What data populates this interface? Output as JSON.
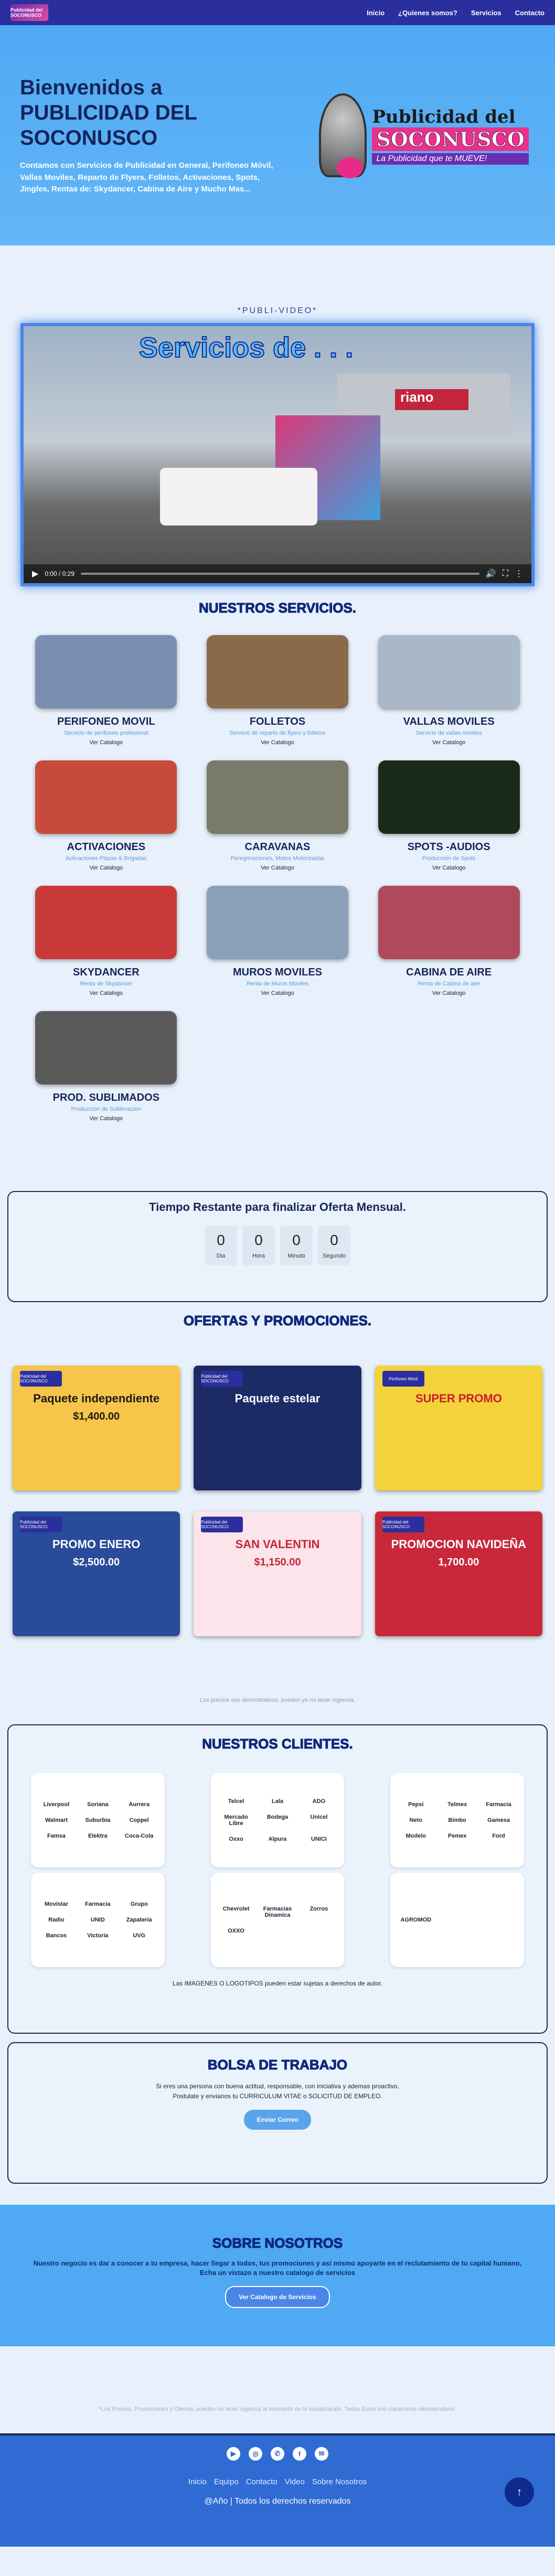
{
  "nav": {
    "logo_text": "Publicidad del SOCONUSCO",
    "links": [
      "Inicio",
      "¿Quienes somos?",
      "Servicios",
      "Contacto"
    ]
  },
  "hero": {
    "title": "Bienvenidos a PUBLICIDAD DEL SOCONUSCO",
    "subtitle": "Contamos con Servicios de Publicidad en General, Perifoneo Móvil, Vallas Moviles, Reparto de Flyers, Folletos, Activaciones, Spots, Jingles, Rentas de: Skydancer, Cabina de Aire y Mucho Mas...",
    "brand_line1": "Publicidad del",
    "brand_line2": "SOCONUSCO",
    "brand_line3": "La Publicidad que te MUEVE!"
  },
  "video": {
    "label": "*PUBLI-VIDEO*",
    "caption": "Servicios de . . .",
    "sign_text": "riano",
    "time": "0:00 / 0:29"
  },
  "services": {
    "title": "NUESTROS SERVICIOS.",
    "items": [
      {
        "title": "PERIFONEO MOVIL",
        "desc": "Servicio de perifoneo profesional",
        "link": "Ver Catalogo",
        "color": "#7a8fb0"
      },
      {
        "title": "FOLLETOS",
        "desc": "Servicio de reparto de flyers y folletos",
        "link": "Ver Catalogo",
        "color": "#8a6a4a"
      },
      {
        "title": "VALLAS MOVILES",
        "desc": "Servicio de vallas moviles",
        "link": "Ver Catalogo",
        "color": "#a8b8c8"
      },
      {
        "title": "ACTIVACIONES",
        "desc": "Activaciones Plazas & Brigadas",
        "link": "Ver Catalogo",
        "color": "#c84a3a"
      },
      {
        "title": "CARAVANAS",
        "desc": "Peregrinaciones, Motos Motorizadas",
        "link": "Ver Catalogo",
        "color": "#7a7a6a"
      },
      {
        "title": "SPOTS -AUDIOS",
        "desc": "Produccion de Spots",
        "link": "Ver Catalogo",
        "color": "#1a2a1a"
      },
      {
        "title": "SKYDANCER",
        "desc": "Renta de Skydancer",
        "link": "Ver Catalogo",
        "color": "#c83a3a"
      },
      {
        "title": "MUROS MOVILES",
        "desc": "Renta de Muros Moviles",
        "link": "Ver Catalogo",
        "color": "#8aa0b8"
      },
      {
        "title": "CABINA DE AIRE",
        "desc": "Renta de Cabina de aire",
        "link": "Ver Catalogo",
        "color": "#b04a5a"
      },
      {
        "title": "PROD. SUBLIMADOS",
        "desc": "Produccion de Sublimacion",
        "link": "Ver Catalogo",
        "color": "#5a5a5a"
      }
    ]
  },
  "countdown": {
    "title": "Tiempo Restante para finalizar Oferta Mensual.",
    "units": [
      {
        "value": "0",
        "label": "Dia"
      },
      {
        "value": "0",
        "label": "Hora"
      },
      {
        "value": "0",
        "label": "Minuto"
      },
      {
        "value": "0",
        "label": "Segundo"
      }
    ]
  },
  "offers": {
    "title": "OFERTAS Y PROMOCIONES.",
    "items": [
      {
        "tag": "Publicidad del SOCONUSCO",
        "title": "Paquete independiente",
        "price": "$1,400.00",
        "bg": "#f6c54a",
        "fg": "#1a1a1a"
      },
      {
        "tag": "Publicidad del SOCONUSCO",
        "title": "Paquete estelar",
        "price": "",
        "bg": "#1c2a66",
        "fg": "#ffffff"
      },
      {
        "tag": "Perifoneo Móvil",
        "title": "SUPER PROMO",
        "price": "",
        "bg": "#f4d23a",
        "fg": "#c81e2a"
      },
      {
        "tag": "Publicidad del SOCONUSCO",
        "title": "PROMO ENERO",
        "price": "$2,500.00",
        "bg": "#2a4a9a",
        "fg": "#ffffff"
      },
      {
        "tag": "Publicidad del SOCONUSCO",
        "title": "SAN VALENTIN",
        "price": "$1,150.00",
        "bg": "#fbe4ea",
        "fg": "#c8243a"
      },
      {
        "tag": "Publicidad del SOCONUSCO",
        "title": "PROMOCION NAVIDEÑA",
        "price": "1,700.00",
        "bg": "#c8283a",
        "fg": "#ffffff"
      }
    ],
    "note": "Los precios son demostrativos, pueden ya no tener vigencia."
  },
  "clients": {
    "title": "NUESTROS CLIENTES.",
    "cards": [
      [
        "Liverpool",
        "Soriana",
        "Aurrera",
        "Walmart",
        "Suburbia",
        "Coppel",
        "Famsa",
        "Elektra",
        "Coca-Cola"
      ],
      [
        "Telcel",
        "Lala",
        "ADO",
        "Mercado Libre",
        "Bodega",
        "Unicel",
        "Oxxo",
        "Alpura",
        "UNICI"
      ],
      [
        "Pepsi",
        "Telmex",
        "Farmacia",
        "Neto",
        "Bimbo",
        "Gamesa",
        "Modelo",
        "Pemex",
        "Ford"
      ],
      [
        "Movistar",
        "Farmacia",
        "Grupo",
        "Radio",
        "UNID",
        "Zapateria",
        "Bancos",
        "Victoria",
        "UVG"
      ],
      [
        "Chevrolet",
        "Farmacias Dinamica",
        "Zorros",
        "OXXO"
      ],
      [
        "AGROMOD"
      ]
    ],
    "note": "Las IMAGENES O LOGOTIPOS pueden estar sujetas a derechos de autor."
  },
  "jobs": {
    "title": "BOLSA DE TRABAJO",
    "text1": "Si eres una persona con buena actitud, responsable, con iniciativa y ademas proactivo,",
    "text2": "Postulate y envianos tu CURRICULUM VITAE o SOLICITUD DE EMPLEO.",
    "button": "Enviar Correo"
  },
  "about": {
    "title": "SOBRE NOSOTROS",
    "text": "Nuestro negocio es dar a conocer a tu empresa, hacer llegar a todos, tus promociones y así mismo apoyarte en el reclutamiento de tu capital humano, Echa un vistazo a nuestro catalogo de servicios",
    "button": "Ver Catalogo de Servicios"
  },
  "disclaimer": "*Los Precios, Promociones y Ofertas, pueden no tener vigencia al momento de la visualización. Todos Estos son claramente demostrativos.",
  "footer": {
    "socials": [
      "YouTube",
      "Instagram",
      "WhatsApp",
      "Facebook",
      "Email"
    ],
    "social_glyphs": [
      "▶",
      "◎",
      "✆",
      "f",
      "✉"
    ],
    "links": [
      "Inicio",
      "Equipo",
      "Contacto",
      "Video",
      "Sobre Nosotros"
    ],
    "copyright": "@Año | Todos los derechos reservados",
    "to_top": "↑"
  }
}
